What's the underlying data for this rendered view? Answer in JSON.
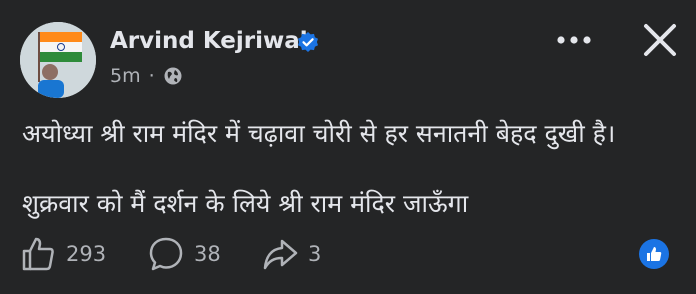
{
  "post": {
    "author": "Arvind Kejriwal",
    "time": "5m",
    "separator": "·",
    "lines": [
      "अयोध्या श्री राम मंदिर में चढ़ावा चोरी से हर सनातनी बेहद दुखी है।",
      "शुक्रवार को मैं दर्शन के लिये श्री राम मंदिर जाऊँगा"
    ]
  },
  "actions": {
    "likes": "293",
    "comments": "38",
    "shares": "3"
  },
  "icons": {
    "verified": "verified-badge-icon",
    "globe": "globe-icon",
    "more": "more-options-icon",
    "close": "close-icon",
    "like": "thumbs-up-icon",
    "comment": "comment-bubble-icon",
    "share": "share-arrow-icon",
    "reaction": "like-reaction-icon"
  },
  "colors": {
    "background": "#242526",
    "text": "#e4e6eb",
    "secondary": "#b0b3b8",
    "accent": "#1b74e4"
  }
}
